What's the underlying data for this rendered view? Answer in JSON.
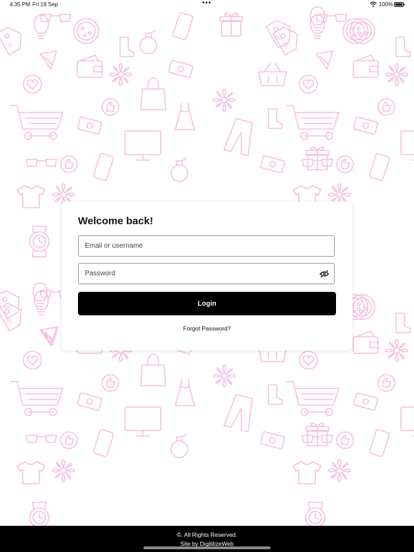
{
  "status_bar": {
    "time": "4:35 PM",
    "date": "Fri 19 Sep",
    "battery_pct": "100%",
    "icons": [
      "wifi-icon",
      "battery-icon"
    ]
  },
  "login": {
    "title": "Welcome back!",
    "email_placeholder": "Email or username",
    "email_value": "",
    "password_placeholder": "Password",
    "password_value": "",
    "login_label": "Login",
    "forgot_label": "Forgot Password?",
    "toggle_icon": "eye-off-icon"
  },
  "footer": {
    "line1": "©. All Rights Reserved.",
    "line2": "Site by DigitilizeWeb"
  },
  "theme": {
    "pattern_color": "#f7bfe0",
    "primary_button": "#000000",
    "footer_bg": "#000000",
    "card_bg": "#ffffff"
  },
  "background_pattern": {
    "icons": [
      "gift-icon",
      "pizza-icon",
      "shopping-cart-icon",
      "tshirt-icon",
      "dress-icon",
      "monitor-icon",
      "smartphone-icon",
      "shopping-bag-icon",
      "wallet-icon",
      "basket-icon",
      "perfume-icon",
      "sunglasses-icon",
      "like-icon",
      "heart-icon",
      "watch-icon",
      "price-tag-icon",
      "lightbulb-icon",
      "flower-icon",
      "money-icon",
      "pants-icon",
      "boot-icon",
      "cake-icon"
    ]
  }
}
